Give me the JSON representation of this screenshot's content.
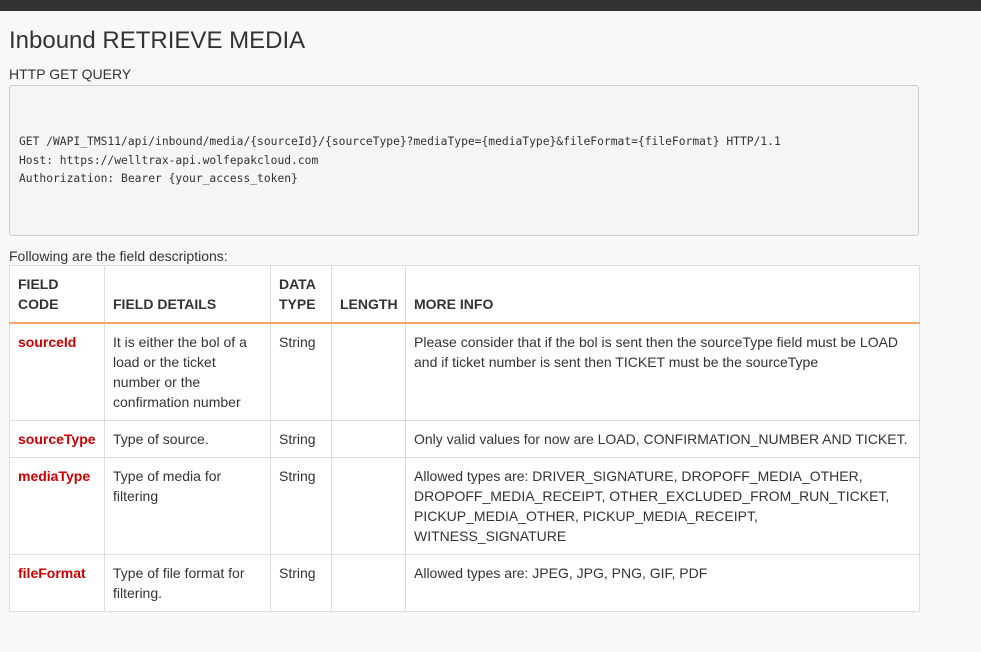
{
  "page": {
    "title": "Inbound RETRIEVE MEDIA",
    "query_label": "HTTP GET QUERY",
    "code_lines": [
      "GET /WAPI_TMS11/api/inbound/media/{sourceId}/{sourceType}?mediaType={mediaType}&fileFormat={fileFormat} HTTP/1.1",
      "Host: https://welltrax-api.wolfepakcloud.com",
      "Authorization: Bearer {your_access_token}"
    ],
    "description": "Following are the field descriptions:"
  },
  "table": {
    "headers": {
      "field_code": "FIELD CODE",
      "field_details": "FIELD DETAILS",
      "data_type": "DATA TYPE",
      "length": "LENGTH",
      "more_info": "MORE INFO"
    },
    "rows": [
      {
        "code": "sourceId",
        "details": "It is either the bol of a load or the ticket number or the confirmation number",
        "type": "String",
        "length": "",
        "info": "Please consider that if the bol is sent then the sourceType field must be LOAD and if ticket number is sent then TICKET must be the sourceType"
      },
      {
        "code": "sourceType",
        "details": "Type of source.",
        "type": "String",
        "length": "",
        "info": "Only valid values for now are LOAD, CONFIRMATION_NUMBER AND TICKET."
      },
      {
        "code": "mediaType",
        "details": "Type of media for filtering",
        "type": "String",
        "length": "",
        "info": "Allowed types are: DRIVER_SIGNATURE, DROPOFF_MEDIA_OTHER, DROPOFF_MEDIA_RECEIPT, OTHER_EXCLUDED_FROM_RUN_TICKET, PICKUP_MEDIA_OTHER, PICKUP_MEDIA_RECEIPT, WITNESS_SIGNATURE"
      },
      {
        "code": "fileFormat",
        "details": "Type of file format for filtering.",
        "type": "String",
        "length": "",
        "info": "Allowed types are: JPEG, JPG, PNG, GIF, PDF"
      }
    ]
  },
  "colors": {
    "field_code": "#cc0000",
    "header_underline": "#f5a66e",
    "topbar": "#333333"
  }
}
